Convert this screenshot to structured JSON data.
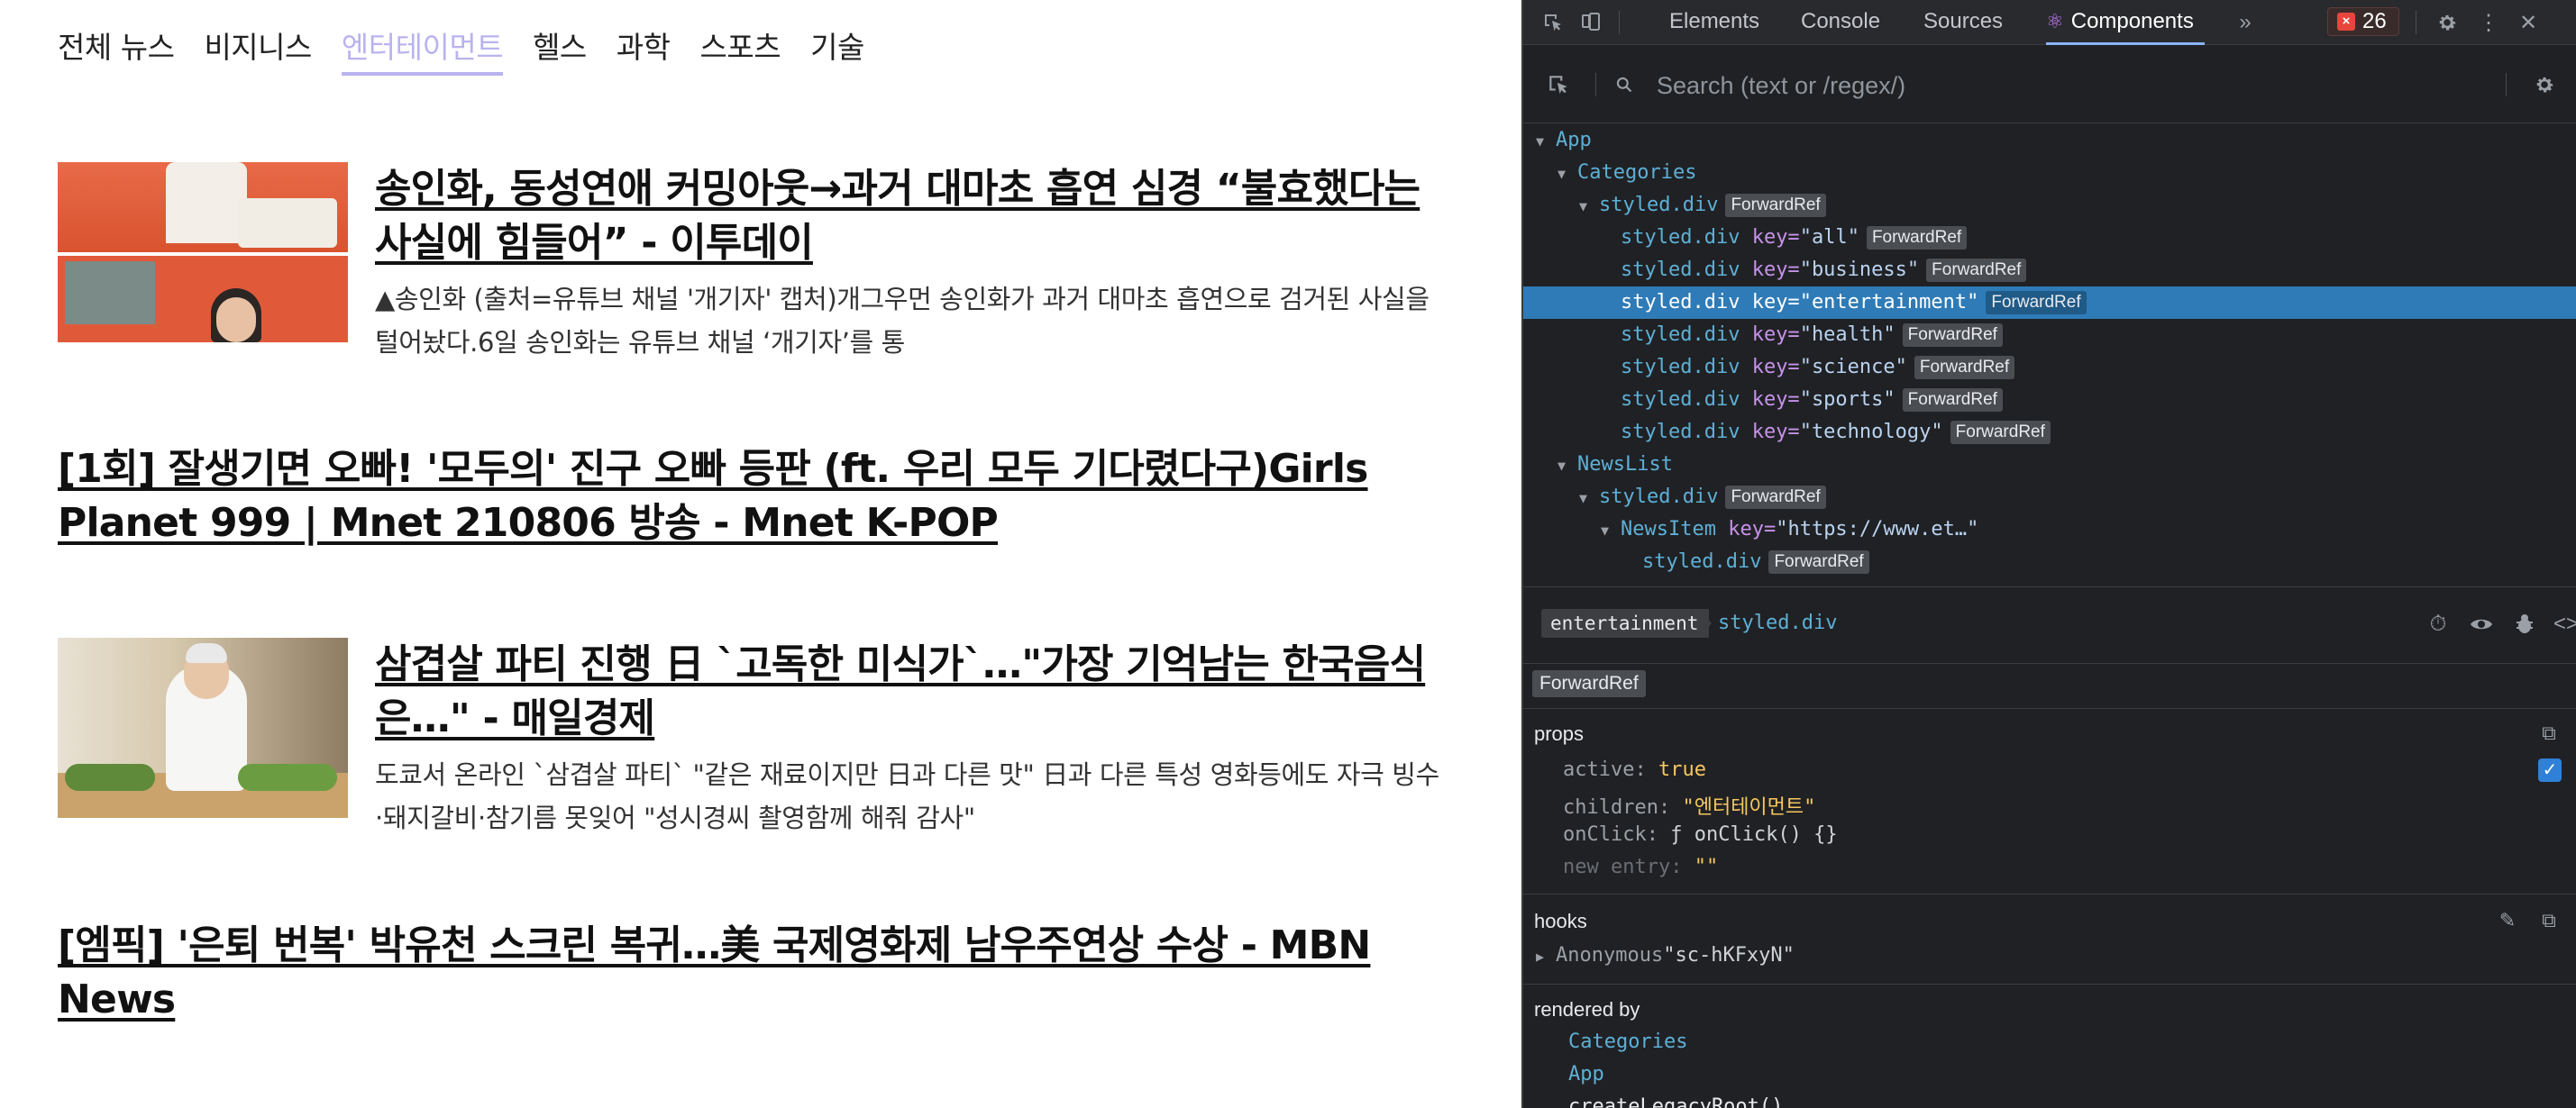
{
  "categories": [
    "전체 뉴스",
    "비지니스",
    "엔터테이먼트",
    "헬스",
    "과학",
    "스포츠",
    "기술"
  ],
  "active_category": "엔터테이먼트",
  "news": [
    {
      "title": "송인화, 동성연애 커밍아웃→과거 대마초 흡연 심경 “불효했다는 사실에 힘들어” - 이투데이",
      "description": "▲송인화 (출처=유튜브 채널 '개기자' 캡처)개그우먼 송인화가 과거 대마초 흡연으로 검거된 사실을 털어놨다.6일 송인화는 유튜브 채널 ‘개기자’를 통",
      "has_image": true
    },
    {
      "title": "[1회] 잘생기면 오빠! '모두의' 진구 오빠 등판 (ft. 우리 모두 기다렸다구)Girls Planet 999 | Mnet 210806 방송 - Mnet K-POP",
      "description": "",
      "has_image": false
    },
    {
      "title": "삼겹살 파티 진행 日 `고독한 미식가`…\"가장 기억남는 한국음식은…\" - 매일경제",
      "description": "도쿄서 온라인 `삼겹살 파티` \"같은 재료이지만 日과 다른 맛\" 日과 다른 특성 영화등에도 자극 빙수·돼지갈비·참기름 못잊어 \"성시경씨 촬영함께 해줘 감사\"",
      "has_image": true
    },
    {
      "title": "[엠픽] '은퇴 번복' 박유천 스크린 복귀…美 국제영화제 남우주연상 수상 - MBN News",
      "description": "",
      "has_image": false
    }
  ],
  "devtools": {
    "tabs": [
      "Elements",
      "Console",
      "Sources",
      "Components"
    ],
    "active_tab": "Components",
    "more_tabs_icon": "double-chevron-right-icon",
    "error_count": "26",
    "search_placeholder": "Search (text or /regex/)",
    "tree": [
      {
        "depth": 0,
        "expanded": true,
        "name": "App",
        "key": "",
        "badge": ""
      },
      {
        "depth": 1,
        "expanded": true,
        "name": "Categories",
        "key": "",
        "badge": ""
      },
      {
        "depth": 2,
        "expanded": true,
        "name": "styled.div",
        "key": "",
        "badge": "ForwardRef"
      },
      {
        "depth": 3,
        "expanded": null,
        "name": "styled.div",
        "key": "all",
        "badge": "ForwardRef"
      },
      {
        "depth": 3,
        "expanded": null,
        "name": "styled.div",
        "key": "business",
        "badge": "ForwardRef"
      },
      {
        "depth": 3,
        "expanded": null,
        "name": "styled.div",
        "key": "entertainment",
        "badge": "ForwardRef",
        "selected": true
      },
      {
        "depth": 3,
        "expanded": null,
        "name": "styled.div",
        "key": "health",
        "badge": "ForwardRef"
      },
      {
        "depth": 3,
        "expanded": null,
        "name": "styled.div",
        "key": "science",
        "badge": "ForwardRef"
      },
      {
        "depth": 3,
        "expanded": null,
        "name": "styled.div",
        "key": "sports",
        "badge": "ForwardRef"
      },
      {
        "depth": 3,
        "expanded": null,
        "name": "styled.div",
        "key": "technology",
        "badge": "ForwardRef"
      },
      {
        "depth": 1,
        "expanded": true,
        "name": "NewsList",
        "key": "",
        "badge": ""
      },
      {
        "depth": 2,
        "expanded": true,
        "name": "styled.div",
        "key": "",
        "badge": "ForwardRef"
      },
      {
        "depth": 3,
        "expanded": true,
        "name": "NewsItem",
        "key": "https://www.et…",
        "badge": ""
      },
      {
        "depth": 4,
        "expanded": null,
        "name": "styled.div",
        "key": "",
        "badge": "ForwardRef"
      }
    ],
    "inspector": {
      "selected_key": "entertainment",
      "selected_name": "styled.div",
      "badge": "ForwardRef",
      "props_title": "props",
      "props": [
        {
          "key": "active",
          "value": "true",
          "type": "bool"
        },
        {
          "key": "children",
          "value": "\"엔터테이먼트\"",
          "type": "str"
        },
        {
          "key": "onClick",
          "value": "ƒ onClick() {}",
          "type": "fn"
        },
        {
          "key": "new entry",
          "value": "\"\"",
          "type": "new"
        }
      ],
      "hooks_title": "hooks",
      "hooks": [
        {
          "name": "Anonymous",
          "value": "\"sc-hKFxyN\""
        }
      ],
      "rendered_by_title": "rendered by",
      "rendered_by": [
        "Categories",
        "App",
        "createLegacyRoot()"
      ]
    }
  }
}
